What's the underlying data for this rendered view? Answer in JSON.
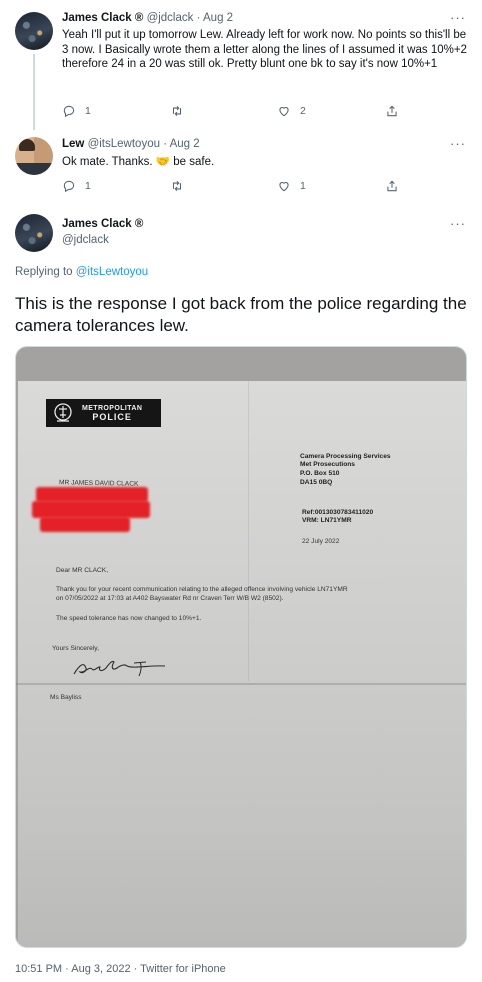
{
  "tweets": [
    {
      "name": "James Clack ®",
      "handle": "@jdclack",
      "time": "Aug 2",
      "text": "Yeah I'll put it up tomorrow Lew. Already left for work now. No points so this'll be 3 now. I Basically wrote them a letter along the lines of I assumed it was 10%+2 therefore 24 in a 20 was still ok. Pretty blunt one bk to say it's now 10%+1",
      "replies": "1",
      "retweets": "",
      "likes": "2"
    },
    {
      "name": "Lew",
      "handle": "@itsLewtoyou",
      "time": "Aug 2",
      "text_before": "Ok mate. Thanks.",
      "emoji": "🤝",
      "text_after": "be safe.",
      "replies": "1",
      "retweets": "",
      "likes": "1"
    }
  ],
  "main_tweet": {
    "name": "James Clack ®",
    "handle": "@jdclack",
    "replying_prefix": "Replying to",
    "replying_to": "@itsLewtoyou",
    "text": "This is the response I got back from the police regarding the camera tolerances lew.",
    "timestamp": "10:51 PM · Aug 3, 2022 · Twitter for iPhone"
  },
  "letter": {
    "logo_line1": "METROPOLITAN",
    "logo_line2": "POLICE",
    "address_line1": "Camera Processing Services",
    "address_line2": "Met Prosecutions",
    "address_line3": "P.O. Box 510",
    "address_line4": "DA15 0BQ",
    "ref": "Ref:0013030783411020",
    "vrm": "VRM: LN71YMR",
    "date": "22 July 2022",
    "recipient": "MR JAMES DAVID CLACK",
    "greeting": "Dear MR CLACK,",
    "para1_line1": "Thank you for your recent communication relating to the alleged offence involving vehicle LN71YMR",
    "para1_line2": "on 07/05/2022 at 17:03 at A402 Bayswater Rd nr Craven Terr W/B W2 (8502).",
    "para2": "The speed tolerance has now changed to 10%+1.",
    "closing": "Yours Sincerely,",
    "signatory": "Ms Bayliss"
  },
  "icons": {
    "reply": "reply-icon",
    "retweet": "retweet-icon",
    "like": "like-icon",
    "share": "share-icon",
    "more": "more-icon"
  },
  "colors": {
    "link": "#1d9bf0",
    "secondary_text": "#536471",
    "redaction": "#e5181e"
  }
}
